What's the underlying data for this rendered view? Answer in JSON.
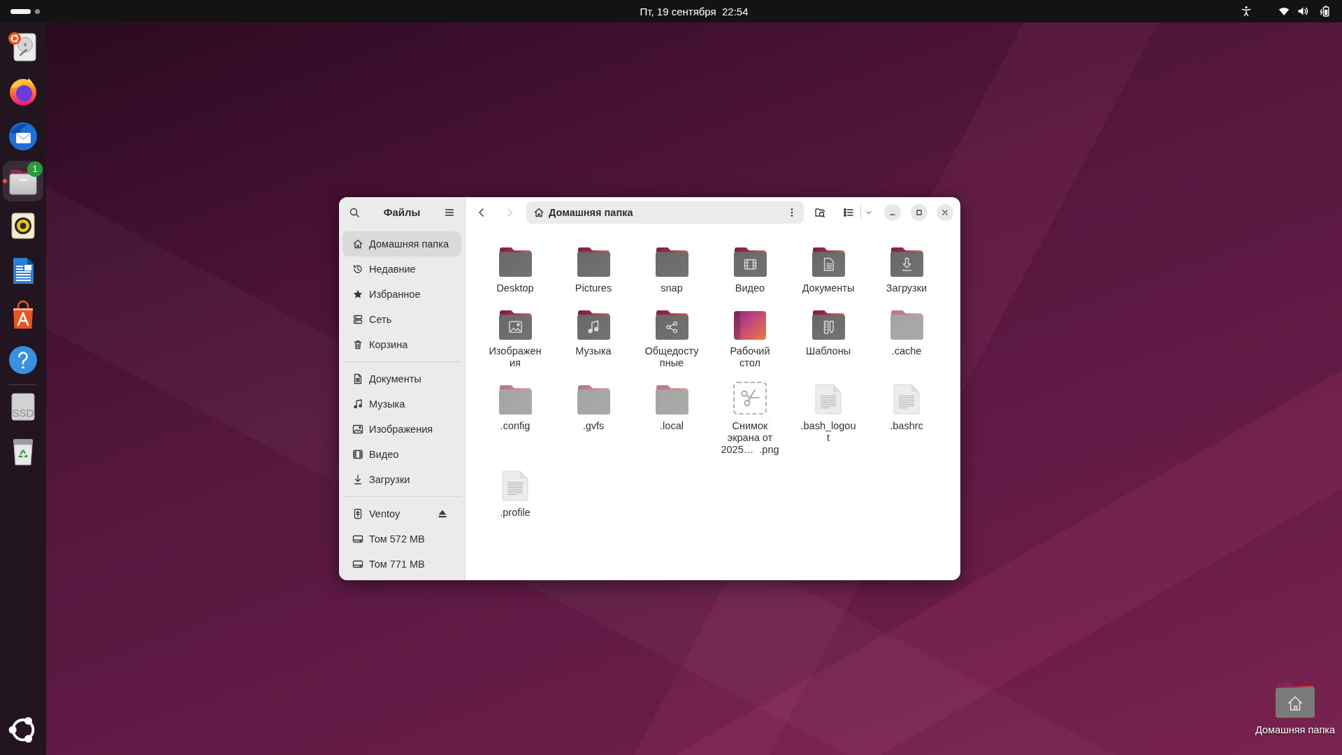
{
  "top_bar": {
    "workspaces": [
      {
        "selected": true
      },
      {
        "selected": false
      }
    ],
    "clock": "Пт, 19 сентября  22:54"
  },
  "dock": {
    "apps": [
      {
        "kind": "installer",
        "running": false,
        "selected": false
      },
      {
        "kind": "browser",
        "running": false,
        "selected": false
      },
      {
        "kind": "mail",
        "running": false,
        "selected": false
      },
      {
        "kind": "files",
        "running": true,
        "selected": true,
        "badge": "1"
      },
      {
        "kind": "player",
        "running": false,
        "selected": false
      },
      {
        "kind": "writer",
        "running": false,
        "selected": false
      },
      {
        "kind": "store",
        "running": false,
        "selected": false
      },
      {
        "kind": "help",
        "running": false,
        "selected": false
      }
    ],
    "devices": [
      {
        "kind": "drive",
        "label": "SSD"
      },
      {
        "kind": "trash"
      }
    ]
  },
  "window": {
    "sidebar": {
      "title": "Файлы",
      "sections": [
        {
          "items": [
            {
              "kind": "home",
              "label": "Домашняя папка",
              "selected": true
            },
            {
              "kind": "recent",
              "label": "Недавние",
              "selected": false
            },
            {
              "kind": "starred",
              "label": "Избранное",
              "selected": false
            },
            {
              "kind": "network",
              "label": "Сеть",
              "selected": false
            },
            {
              "kind": "trash",
              "label": "Корзина",
              "selected": false
            }
          ]
        },
        {
          "items": [
            {
              "kind": "documents",
              "label": "Документы",
              "selected": false
            },
            {
              "kind": "music",
              "label": "Музыка",
              "selected": false
            },
            {
              "kind": "pictures",
              "label": "Изображения",
              "selected": false
            },
            {
              "kind": "videos",
              "label": "Видео",
              "selected": false
            },
            {
              "kind": "downloads",
              "label": "Загрузки",
              "selected": false
            }
          ]
        },
        {
          "items": [
            {
              "kind": "usb",
              "label": "Ventoy",
              "selected": false,
              "ejectable": true
            },
            {
              "kind": "drive",
              "label": "Том 572 MB",
              "selected": false,
              "ejectable": false
            },
            {
              "kind": "drive",
              "label": "Том 771 MB",
              "selected": false,
              "ejectable": false
            }
          ]
        }
      ]
    },
    "toolbar": {
      "back": {
        "disabled": false
      },
      "forward": {
        "disabled": true
      },
      "location": "Домашняя папка"
    },
    "files": [
      {
        "kind": "folder",
        "hidden": false,
        "label_lines": [
          "Desktop"
        ]
      },
      {
        "kind": "folder",
        "hidden": false,
        "label_lines": [
          "Pictures"
        ]
      },
      {
        "kind": "folder",
        "hidden": false,
        "label_lines": [
          "snap"
        ]
      },
      {
        "kind": "videos",
        "hidden": false,
        "label_lines": [
          "Видео"
        ]
      },
      {
        "kind": "documents",
        "hidden": false,
        "label_lines": [
          "Документы"
        ]
      },
      {
        "kind": "downloads",
        "hidden": false,
        "label_lines": [
          "Загрузки"
        ]
      },
      {
        "kind": "pictures",
        "hidden": false,
        "label_lines": [
          "Изображен",
          "ия"
        ]
      },
      {
        "kind": "music",
        "hidden": false,
        "label_lines": [
          "Музыка"
        ]
      },
      {
        "kind": "public",
        "hidden": false,
        "label_lines": [
          "Общедосту",
          "пные"
        ]
      },
      {
        "kind": "desktop",
        "hidden": false,
        "label_lines": [
          "Рабочий",
          "стол"
        ]
      },
      {
        "kind": "templates",
        "hidden": false,
        "label_lines": [
          "Шаблоны"
        ]
      },
      {
        "kind": "folder",
        "hidden": true,
        "label_lines": [
          ".cache"
        ]
      },
      {
        "kind": "folder",
        "hidden": true,
        "label_lines": [
          ".config"
        ]
      },
      {
        "kind": "folder",
        "hidden": true,
        "label_lines": [
          ".gvfs"
        ]
      },
      {
        "kind": "folder",
        "hidden": true,
        "label_lines": [
          ".local"
        ]
      },
      {
        "kind": "screenshot",
        "hidden": false,
        "label_lines": [
          "Снимок",
          "экрана от",
          "2025…  .png"
        ]
      },
      {
        "kind": "textfile",
        "hidden": true,
        "label_lines": [
          ".bash_logou",
          "t"
        ]
      },
      {
        "kind": "textfile",
        "hidden": true,
        "label_lines": [
          ".bashrc"
        ]
      },
      {
        "kind": "textfile",
        "hidden": true,
        "label_lines": [
          ".profile"
        ]
      }
    ]
  },
  "desktop": {
    "icons": [
      {
        "kind": "home",
        "label": "Домашняя папка"
      }
    ]
  }
}
